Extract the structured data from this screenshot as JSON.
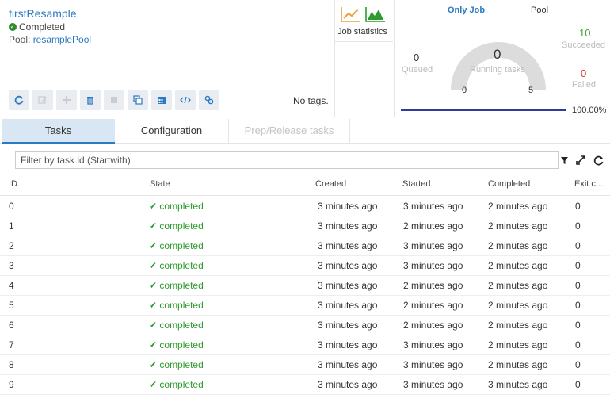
{
  "job": {
    "title": "firstResample",
    "status": "Completed",
    "pool_prefix": "Pool: ",
    "pool_name": "resamplePool",
    "no_tags": "No tags."
  },
  "toolbar": {
    "buttons": [
      {
        "icon": "refresh-icon",
        "state": "active"
      },
      {
        "icon": "edit-icon",
        "state": "disabled"
      },
      {
        "icon": "add-icon",
        "state": "disabled"
      },
      {
        "icon": "delete-icon",
        "state": "active"
      },
      {
        "icon": "stop-icon",
        "state": "disabled"
      },
      {
        "icon": "clone-icon",
        "state": "active"
      },
      {
        "icon": "schedule-icon",
        "state": "active"
      },
      {
        "icon": "code-icon",
        "state": "active"
      },
      {
        "icon": "link-icon",
        "state": "active"
      }
    ]
  },
  "stats": {
    "label": "Job statistics"
  },
  "gauge": {
    "tab_job": "Only Job",
    "tab_pool": "Pool",
    "queued_value": "0",
    "queued_label": "Queued",
    "running_value": "0",
    "running_label": "Running tasks",
    "min": "0",
    "max": "5",
    "succeeded_value": "10",
    "succeeded_label": "Succeeded",
    "failed_value": "0",
    "failed_label": "Failed",
    "progress_percent": "100.00%",
    "progress_fraction": 1.0,
    "colors": {
      "accent": "#2b79c2",
      "success": "#3aa63a",
      "fail": "#d9342b",
      "progress": "#2f3a9c"
    }
  },
  "tabs": [
    "Tasks",
    "Configuration",
    "Prep/Release tasks"
  ],
  "filter": {
    "placeholder": "Filter by task id (Startwith)"
  },
  "table": {
    "headers": [
      "ID",
      "State",
      "Created",
      "Started",
      "Completed",
      "Exit c..."
    ],
    "rows": [
      {
        "id": "0",
        "state": "completed",
        "created": "3 minutes ago",
        "started": "3 minutes ago",
        "completed": "2 minutes ago",
        "exit": "0"
      },
      {
        "id": "1",
        "state": "completed",
        "created": "3 minutes ago",
        "started": "2 minutes ago",
        "completed": "2 minutes ago",
        "exit": "0"
      },
      {
        "id": "2",
        "state": "completed",
        "created": "3 minutes ago",
        "started": "3 minutes ago",
        "completed": "2 minutes ago",
        "exit": "0"
      },
      {
        "id": "3",
        "state": "completed",
        "created": "3 minutes ago",
        "started": "3 minutes ago",
        "completed": "2 minutes ago",
        "exit": "0"
      },
      {
        "id": "4",
        "state": "completed",
        "created": "3 minutes ago",
        "started": "2 minutes ago",
        "completed": "2 minutes ago",
        "exit": "0"
      },
      {
        "id": "5",
        "state": "completed",
        "created": "3 minutes ago",
        "started": "2 minutes ago",
        "completed": "2 minutes ago",
        "exit": "0"
      },
      {
        "id": "6",
        "state": "completed",
        "created": "3 minutes ago",
        "started": "2 minutes ago",
        "completed": "2 minutes ago",
        "exit": "0"
      },
      {
        "id": "7",
        "state": "completed",
        "created": "3 minutes ago",
        "started": "3 minutes ago",
        "completed": "2 minutes ago",
        "exit": "0"
      },
      {
        "id": "8",
        "state": "completed",
        "created": "3 minutes ago",
        "started": "3 minutes ago",
        "completed": "2 minutes ago",
        "exit": "0"
      },
      {
        "id": "9",
        "state": "completed",
        "created": "3 minutes ago",
        "started": "3 minutes ago",
        "completed": "3 minutes ago",
        "exit": "0"
      }
    ]
  }
}
